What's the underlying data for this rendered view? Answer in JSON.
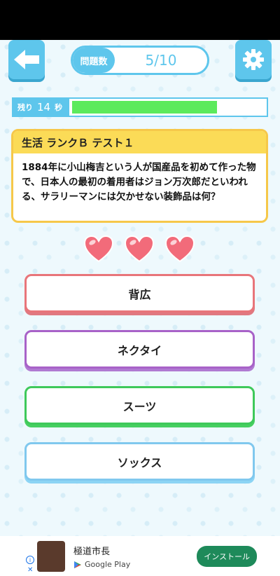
{
  "header": {
    "question_count_label": "問題数",
    "question_count_value": "5/10"
  },
  "timer": {
    "label_left": "残り",
    "seconds": "14",
    "label_right": "秒",
    "progress": 0.75
  },
  "question": {
    "header": "生活 ランクＢ テスト１",
    "text": "1884年に小山梅吉という人が国産品を初めて作った物で、日本人の最初の着用者はジョン万次郎だといわれる、サラリーマンには欠かせない装飾品は何？"
  },
  "lives": {
    "count": 3
  },
  "answers": [
    {
      "label": "背広",
      "color": "#e8757a",
      "shadow": "#e07880"
    },
    {
      "label": "ネクタイ",
      "color": "#a862c8",
      "shadow": "#b07ad2"
    },
    {
      "label": "スーツ",
      "color": "#3ec95a",
      "shadow": "#46cf60"
    },
    {
      "label": "ソックス",
      "color": "#80c8ee",
      "shadow": "#8cd4f4"
    }
  ],
  "ad": {
    "app_name": "極道市長",
    "store": "Google Play",
    "install_label": "インストール"
  },
  "colors": {
    "accent": "#5ec6ec",
    "card_border": "#f6c84a",
    "heart": "#f26b7a"
  }
}
